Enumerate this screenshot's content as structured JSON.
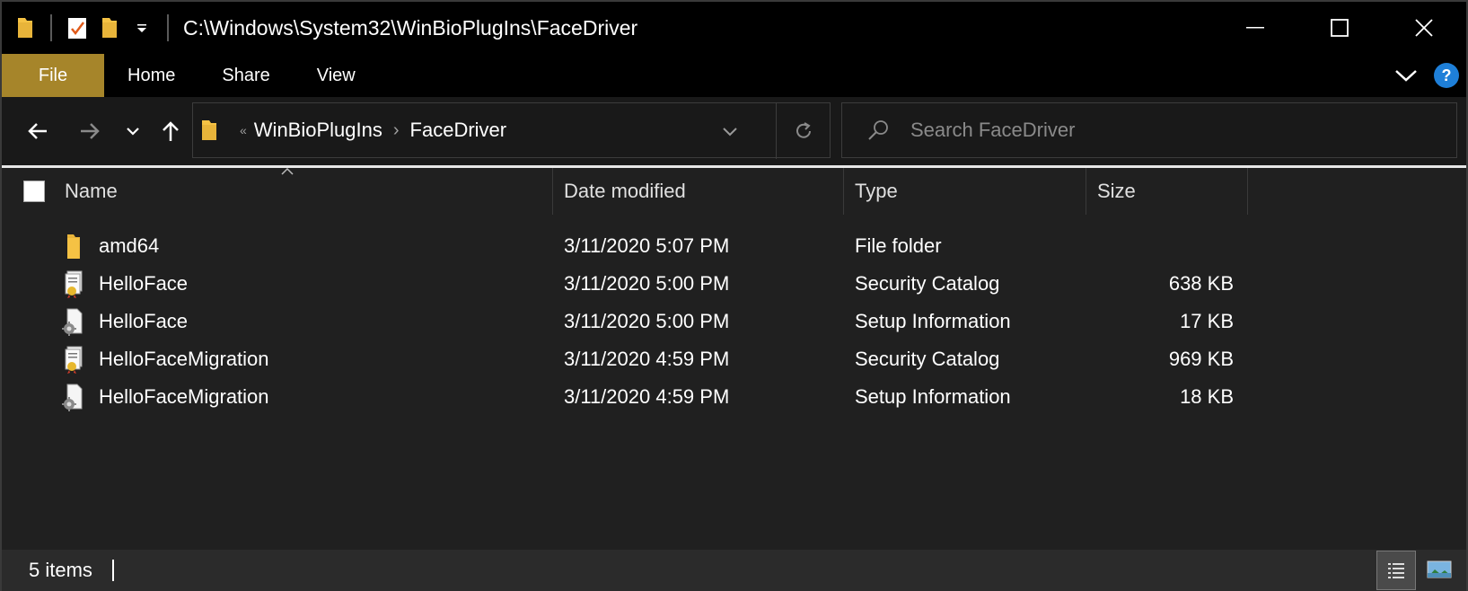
{
  "titlebar": {
    "path": "C:\\Windows\\System32\\WinBioPlugIns\\FaceDriver"
  },
  "ribbon": {
    "tabs": [
      "File",
      "Home",
      "Share",
      "View"
    ],
    "help_label": "?"
  },
  "nav": {
    "breadcrumb_overflow": "«",
    "breadcrumb": [
      "WinBioPlugIns",
      "FaceDriver"
    ],
    "crumb_separator": "›"
  },
  "search": {
    "placeholder": "Search FaceDriver"
  },
  "columns": {
    "name": "Name",
    "date": "Date modified",
    "type": "Type",
    "size": "Size"
  },
  "files": [
    {
      "name": "amd64",
      "date": "3/11/2020 5:07 PM",
      "type": "File folder",
      "size": "",
      "icon": "folder-icon"
    },
    {
      "name": "HelloFace",
      "date": "3/11/2020 5:00 PM",
      "type": "Security Catalog",
      "size": "638 KB",
      "icon": "security-catalog-icon"
    },
    {
      "name": "HelloFace",
      "date": "3/11/2020 5:00 PM",
      "type": "Setup Information",
      "size": "17 KB",
      "icon": "setup-information-icon"
    },
    {
      "name": "HelloFaceMigration",
      "date": "3/11/2020 4:59 PM",
      "type": "Security Catalog",
      "size": "969 KB",
      "icon": "security-catalog-icon"
    },
    {
      "name": "HelloFaceMigration",
      "date": "3/11/2020 4:59 PM",
      "type": "Setup Information",
      "size": "18 KB",
      "icon": "setup-information-icon"
    }
  ],
  "status": {
    "item_count": "5 items"
  },
  "colors": {
    "file_tab": "#a6852a",
    "folder": "#f5c244",
    "help": "#1e7fd8",
    "background": "#202020"
  }
}
